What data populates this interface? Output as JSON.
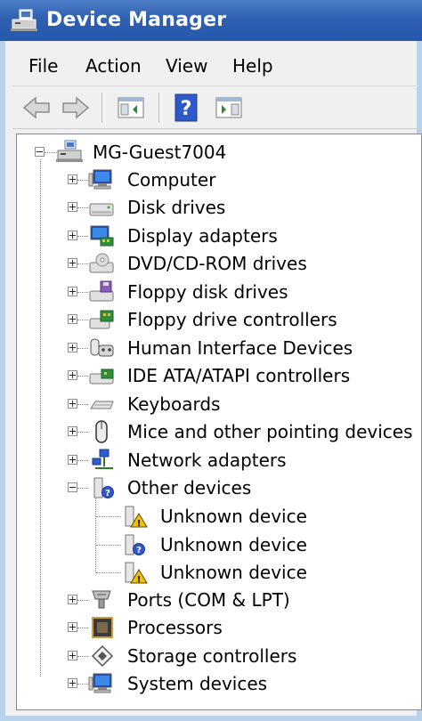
{
  "window": {
    "title": "Device Manager"
  },
  "menu": [
    "File",
    "Action",
    "View",
    "Help"
  ],
  "toolbar": {
    "buttons": [
      {
        "icon": "back-arrow-icon"
      },
      {
        "icon": "forward-arrow-icon"
      },
      {
        "icon": "show-hide-console-tree-icon"
      },
      {
        "icon": "help-icon",
        "text": "?"
      },
      {
        "icon": "action-pane-icon"
      }
    ]
  },
  "tree": {
    "root": {
      "label": "MG-Guest7004",
      "expanded": true,
      "icon": "computer-network-icon"
    },
    "categories": [
      {
        "label": "Computer",
        "expanded": false,
        "icon": "computer-icon"
      },
      {
        "label": "Disk drives",
        "expanded": false,
        "icon": "disk-drive-icon"
      },
      {
        "label": "Display adapters",
        "expanded": false,
        "icon": "display-adapter-icon"
      },
      {
        "label": "DVD/CD-ROM drives",
        "expanded": false,
        "icon": "dvd-drive-icon"
      },
      {
        "label": "Floppy disk drives",
        "expanded": false,
        "icon": "floppy-drive-icon"
      },
      {
        "label": "Floppy drive controllers",
        "expanded": false,
        "icon": "floppy-controller-icon"
      },
      {
        "label": "Human Interface Devices",
        "expanded": false,
        "icon": "hid-icon"
      },
      {
        "label": "IDE ATA/ATAPI controllers",
        "expanded": false,
        "icon": "ide-controller-icon"
      },
      {
        "label": "Keyboards",
        "expanded": false,
        "icon": "keyboard-icon"
      },
      {
        "label": "Mice and other pointing devices",
        "expanded": false,
        "icon": "mouse-icon"
      },
      {
        "label": "Network adapters",
        "expanded": false,
        "icon": "network-adapter-icon"
      },
      {
        "label": "Other devices",
        "expanded": true,
        "icon": "other-devices-icon",
        "children": [
          {
            "label": "Unknown device",
            "icon": "unknown-device-warning-icon"
          },
          {
            "label": "Unknown device",
            "icon": "unknown-device-question-icon"
          },
          {
            "label": "Unknown device",
            "icon": "unknown-device-warning-icon"
          }
        ]
      },
      {
        "label": "Ports (COM & LPT)",
        "expanded": false,
        "icon": "ports-icon"
      },
      {
        "label": "Processors",
        "expanded": false,
        "icon": "processor-icon"
      },
      {
        "label": "Storage controllers",
        "expanded": false,
        "icon": "storage-controller-icon"
      },
      {
        "label": "System devices",
        "expanded": false,
        "icon": "system-devices-icon"
      }
    ]
  }
}
